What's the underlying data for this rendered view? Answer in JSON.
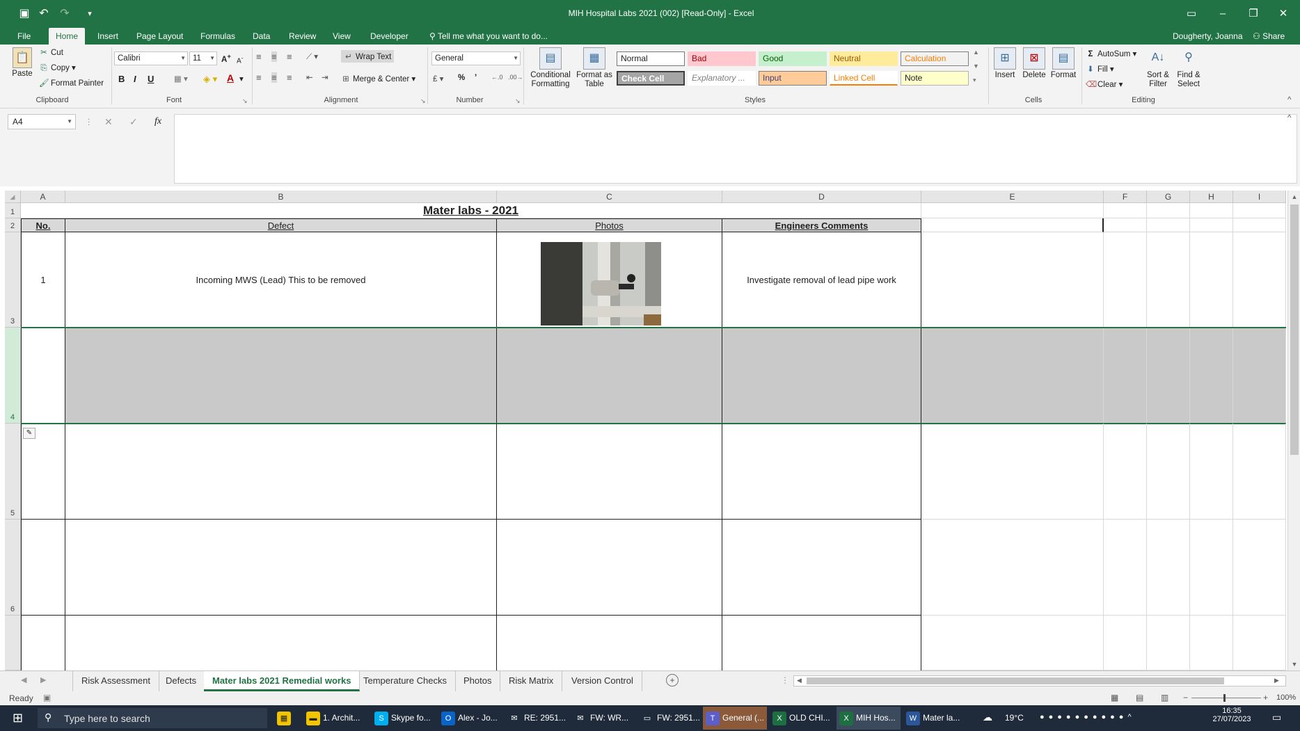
{
  "window": {
    "title": "MIH Hospital Labs 2021 (002)  [Read-Only] - Excel",
    "user": "Dougherty, Joanna",
    "share_label": "Share",
    "minimize": "–",
    "restore": "❐",
    "close": "✕"
  },
  "ribbon_tabs": [
    "File",
    "Home",
    "Insert",
    "Page Layout",
    "Formulas",
    "Data",
    "Review",
    "View",
    "Developer"
  ],
  "tell_me": "Tell me what you want to do...",
  "clipboard": {
    "paste": "Paste",
    "cut": "Cut",
    "copy": "Copy",
    "format_painter": "Format Painter",
    "label": "Clipboard"
  },
  "font": {
    "name": "Calibri",
    "size": "11",
    "label": "Font",
    "bold": "B",
    "italic": "I",
    "underline": "U"
  },
  "alignment": {
    "wrap_text": "Wrap Text",
    "merge_center": "Merge & Center",
    "label": "Alignment"
  },
  "number": {
    "format": "General",
    "percent": "%",
    "comma": "’",
    "label": "Number"
  },
  "styles_group": {
    "conditional": "Conditional Formatting",
    "format_as_table": "Format as Table",
    "label": "Styles",
    "items": [
      {
        "name": "Normal",
        "bg": "#ffffff",
        "color": "#222222"
      },
      {
        "name": "Bad",
        "bg": "#ffc7ce",
        "color": "#9c0006"
      },
      {
        "name": "Good",
        "bg": "#c6efce",
        "color": "#006100"
      },
      {
        "name": "Neutral",
        "bg": "#ffeb9c",
        "color": "#9c5700"
      },
      {
        "name": "Calculation",
        "bg": "#f2f2f2",
        "color": "#fa7d00"
      },
      {
        "name": "Check Cell",
        "bg": "#a5a5a5",
        "color": "#ffffff"
      },
      {
        "name": "Explanatory ...",
        "bg": "#ffffff",
        "color": "#7f7f7f"
      },
      {
        "name": "Input",
        "bg": "#ffcc99",
        "color": "#3f3f76"
      },
      {
        "name": "Linked Cell",
        "bg": "#ffffff",
        "color": "#fa7d00"
      },
      {
        "name": "Note",
        "bg": "#ffffcc",
        "color": "#222222"
      }
    ]
  },
  "cells_group": {
    "insert": "Insert",
    "delete": "Delete",
    "format": "Format",
    "label": "Cells"
  },
  "editing_group": {
    "autosum": "AutoSum",
    "fill": "Fill",
    "clear": "Clear",
    "sort_filter": "Sort & Filter",
    "find_select": "Find & Select",
    "label": "Editing"
  },
  "formula_bar": {
    "name_box": "A4",
    "fx": "fx",
    "value": ""
  },
  "columns": [
    "A",
    "B",
    "C",
    "D",
    "E",
    "F",
    "G",
    "H",
    "I"
  ],
  "rows": [
    "1",
    "2",
    "3",
    "4",
    "5",
    "6"
  ],
  "sheet": {
    "title": "Mater labs - 2021",
    "headers": {
      "no": "No.",
      "defect": "Defect",
      "photos": "Photos",
      "comments": "Engineers Comments"
    },
    "row1": {
      "no": "1",
      "defect": "Incoming MWS (Lead) This to be removed",
      "comments": "Investigate removal of lead pipe work"
    }
  },
  "sheet_tabs": [
    "Risk Assessment",
    "Defects",
    "Mater labs 2021 Remedial works",
    "Temperature Checks",
    "Photos",
    "Risk Matrix",
    "Version Control"
  ],
  "active_sheet": "Mater labs 2021 Remedial works",
  "status": {
    "ready": "Ready",
    "zoom": "100%"
  },
  "taskbar": {
    "search_placeholder": "Type here to search",
    "items": [
      "1. Archit...",
      "Skype fo...",
      "Alex - Jo...",
      "RE: 2951...",
      "FW: WR...",
      "FW: 2951...",
      "General (...",
      "OLD CHI...",
      "MIH Hos...",
      "Mater la..."
    ],
    "weather": "19°C",
    "time": "16:35",
    "date": "27/07/2023"
  },
  "colors": {
    "excel_green": "#217346",
    "selection_green": "#217346",
    "grey_row": "#c9c9c9"
  }
}
